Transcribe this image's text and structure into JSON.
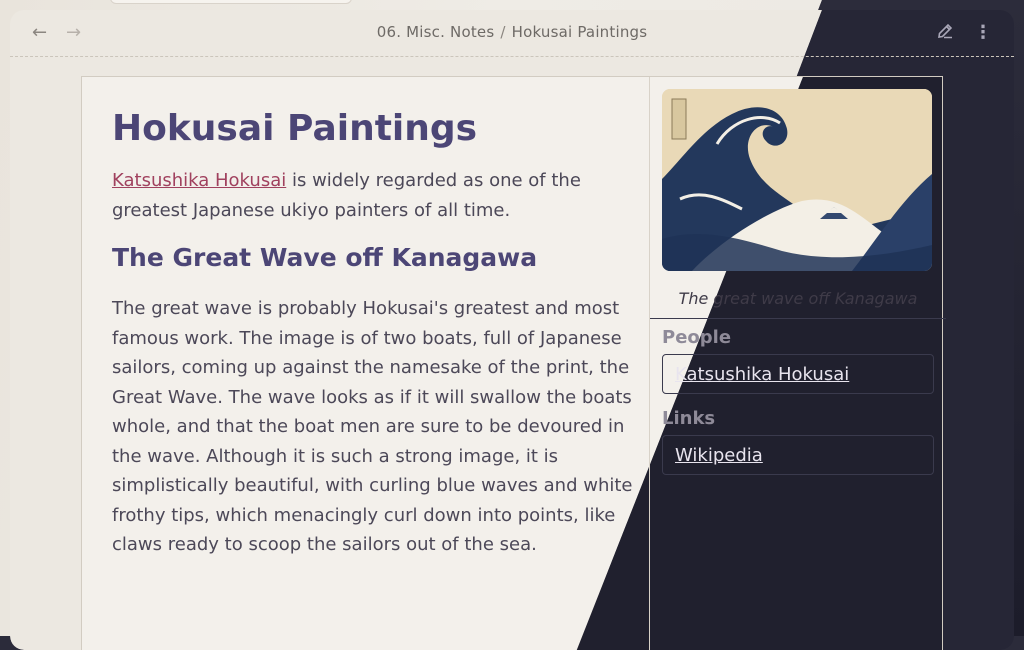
{
  "header": {
    "breadcrumb": [
      "06. Misc. Notes",
      "Hokusai Paintings"
    ],
    "separator": "/"
  },
  "note": {
    "title": "Hokusai Paintings",
    "intro_link": "Katsushika Hokusai",
    "intro_rest": " is widely regarded as one of the greatest Japanese ukiyo painters of all time.",
    "section_title": "The Great Wave off Kanagawa",
    "section_body": "The great wave is probably Hokusai's greatest and most famous work. The image is of two boats, full of Japanese sailors, coming up against the namesake of the print, the Great Wave. The wave looks as if it will swallow the boats whole, and that the boat men are sure to be devoured in the wave. Although it is such a strong image, it is simplistically beautiful, with curling blue waves and white frothy tips, which menacingly curl down into points, like claws ready to scoop the sailors out of the sea."
  },
  "sidebar": {
    "image_caption": "The great wave off Kanagawa",
    "people_label": "People",
    "people_link": "Katsushika Hokusai",
    "links_label": "Links",
    "links_link": "Wikipedia"
  },
  "icons": {
    "back": "arrow-left-icon",
    "forward": "arrow-right-icon",
    "edit": "pencil-icon",
    "more": "more-vertical-icon"
  }
}
